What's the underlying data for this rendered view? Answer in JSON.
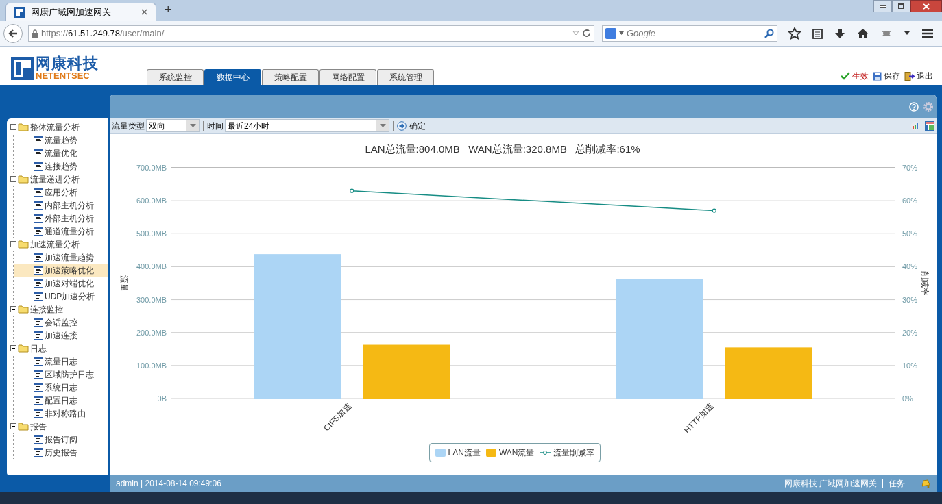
{
  "browser": {
    "tab_title": "网康广域网加速网关",
    "new_tab": "+",
    "url": {
      "scheme": "https://",
      "host": "61.51.249.78",
      "path": "/user/main/"
    },
    "search_placeholder": "Google"
  },
  "header": {
    "logo_cn": "网康科技",
    "logo_en": "NETENTSEC",
    "tabs": [
      {
        "label": "系统监控",
        "selected": false
      },
      {
        "label": "数据中心",
        "selected": true
      },
      {
        "label": "策略配置",
        "selected": false
      },
      {
        "label": "网络配置",
        "selected": false
      },
      {
        "label": "系统管理",
        "selected": false
      }
    ],
    "actions": [
      {
        "kind": "apply",
        "label": "生效"
      },
      {
        "kind": "save",
        "label": "保存"
      },
      {
        "kind": "exit",
        "label": "退出"
      }
    ]
  },
  "sidebar": {
    "tree": [
      {
        "label": "整体流量分析",
        "expanded": true,
        "children": [
          {
            "label": "流量趋势",
            "selected": false
          },
          {
            "label": "流量优化",
            "selected": false
          },
          {
            "label": "连接趋势",
            "selected": false
          }
        ]
      },
      {
        "label": "流量递进分析",
        "expanded": true,
        "children": [
          {
            "label": "应用分析",
            "selected": false
          },
          {
            "label": "内部主机分析",
            "selected": false
          },
          {
            "label": "外部主机分析",
            "selected": false
          },
          {
            "label": "通道流量分析",
            "selected": false
          }
        ]
      },
      {
        "label": "加速流量分析",
        "expanded": true,
        "children": [
          {
            "label": "加速流量趋势",
            "selected": false
          },
          {
            "label": "加速策略优化",
            "selected": true
          },
          {
            "label": "加速对端优化",
            "selected": false
          },
          {
            "label": "UDP加速分析",
            "selected": false
          }
        ]
      },
      {
        "label": "连接监控",
        "expanded": true,
        "children": [
          {
            "label": "会话监控",
            "selected": false
          },
          {
            "label": "加速连接",
            "selected": false
          }
        ]
      },
      {
        "label": "日志",
        "expanded": true,
        "children": [
          {
            "label": "流量日志",
            "selected": false
          },
          {
            "label": "区域防护日志",
            "selected": false
          },
          {
            "label": "系统日志",
            "selected": false
          },
          {
            "label": "配置日志",
            "selected": false
          },
          {
            "label": "非对称路由",
            "selected": false
          }
        ]
      },
      {
        "label": "报告",
        "expanded": true,
        "children": [
          {
            "label": "报告订阅",
            "selected": false
          },
          {
            "label": "历史报告",
            "selected": false
          }
        ]
      }
    ]
  },
  "toolbar": {
    "traffic_type_label": "流量类型",
    "traffic_type": "双向",
    "time_label": "时间",
    "time": "最近24小时",
    "confirm": "确定"
  },
  "chart_data": {
    "type": "bar",
    "stacked": false,
    "grid": true,
    "title": "LAN总流量:804.0MB   WAN总流量:320.8MB   总削减率:61%",
    "ylabel": "流量",
    "y2label": "削减率",
    "categories": [
      "CIFS加速",
      "HTTP加速"
    ],
    "series": [
      {
        "name": "LAN流量",
        "color": "#acd5f5",
        "type": "bar",
        "values": [
          438,
          362
        ]
      },
      {
        "name": "WAN流量",
        "color": "#f5b914",
        "type": "bar",
        "values": [
          163,
          155
        ]
      },
      {
        "name": "流量削减率",
        "color": "#168c84",
        "type": "line",
        "axis": "y2",
        "marker": "o",
        "values": [
          63,
          57
        ]
      }
    ],
    "ylim": [
      0,
      700
    ],
    "y2lim": [
      0,
      70
    ],
    "yticks": [
      {
        "value": 0,
        "label": "0B"
      },
      {
        "value": 100,
        "label": "100.0MB"
      },
      {
        "value": 200,
        "label": "200.0MB"
      },
      {
        "value": 300,
        "label": "300.0MB"
      },
      {
        "value": 400,
        "label": "400.0MB"
      },
      {
        "value": 500,
        "label": "500.0MB"
      },
      {
        "value": 600,
        "label": "600.0MB"
      },
      {
        "value": 700,
        "label": "700.0MB"
      }
    ],
    "y2ticks": [
      {
        "value": 0,
        "label": "0%"
      },
      {
        "value": 10,
        "label": "10%"
      },
      {
        "value": 20,
        "label": "20%"
      },
      {
        "value": 30,
        "label": "30%"
      },
      {
        "value": 40,
        "label": "40%"
      },
      {
        "value": 50,
        "label": "50%"
      },
      {
        "value": 60,
        "label": "60%"
      },
      {
        "value": 70,
        "label": "70%"
      }
    ]
  },
  "footer": {
    "user_time": "admin | 2014-08-14 09:49:06",
    "product": "网康科技 广域网加速网关",
    "tasks": "任务"
  }
}
